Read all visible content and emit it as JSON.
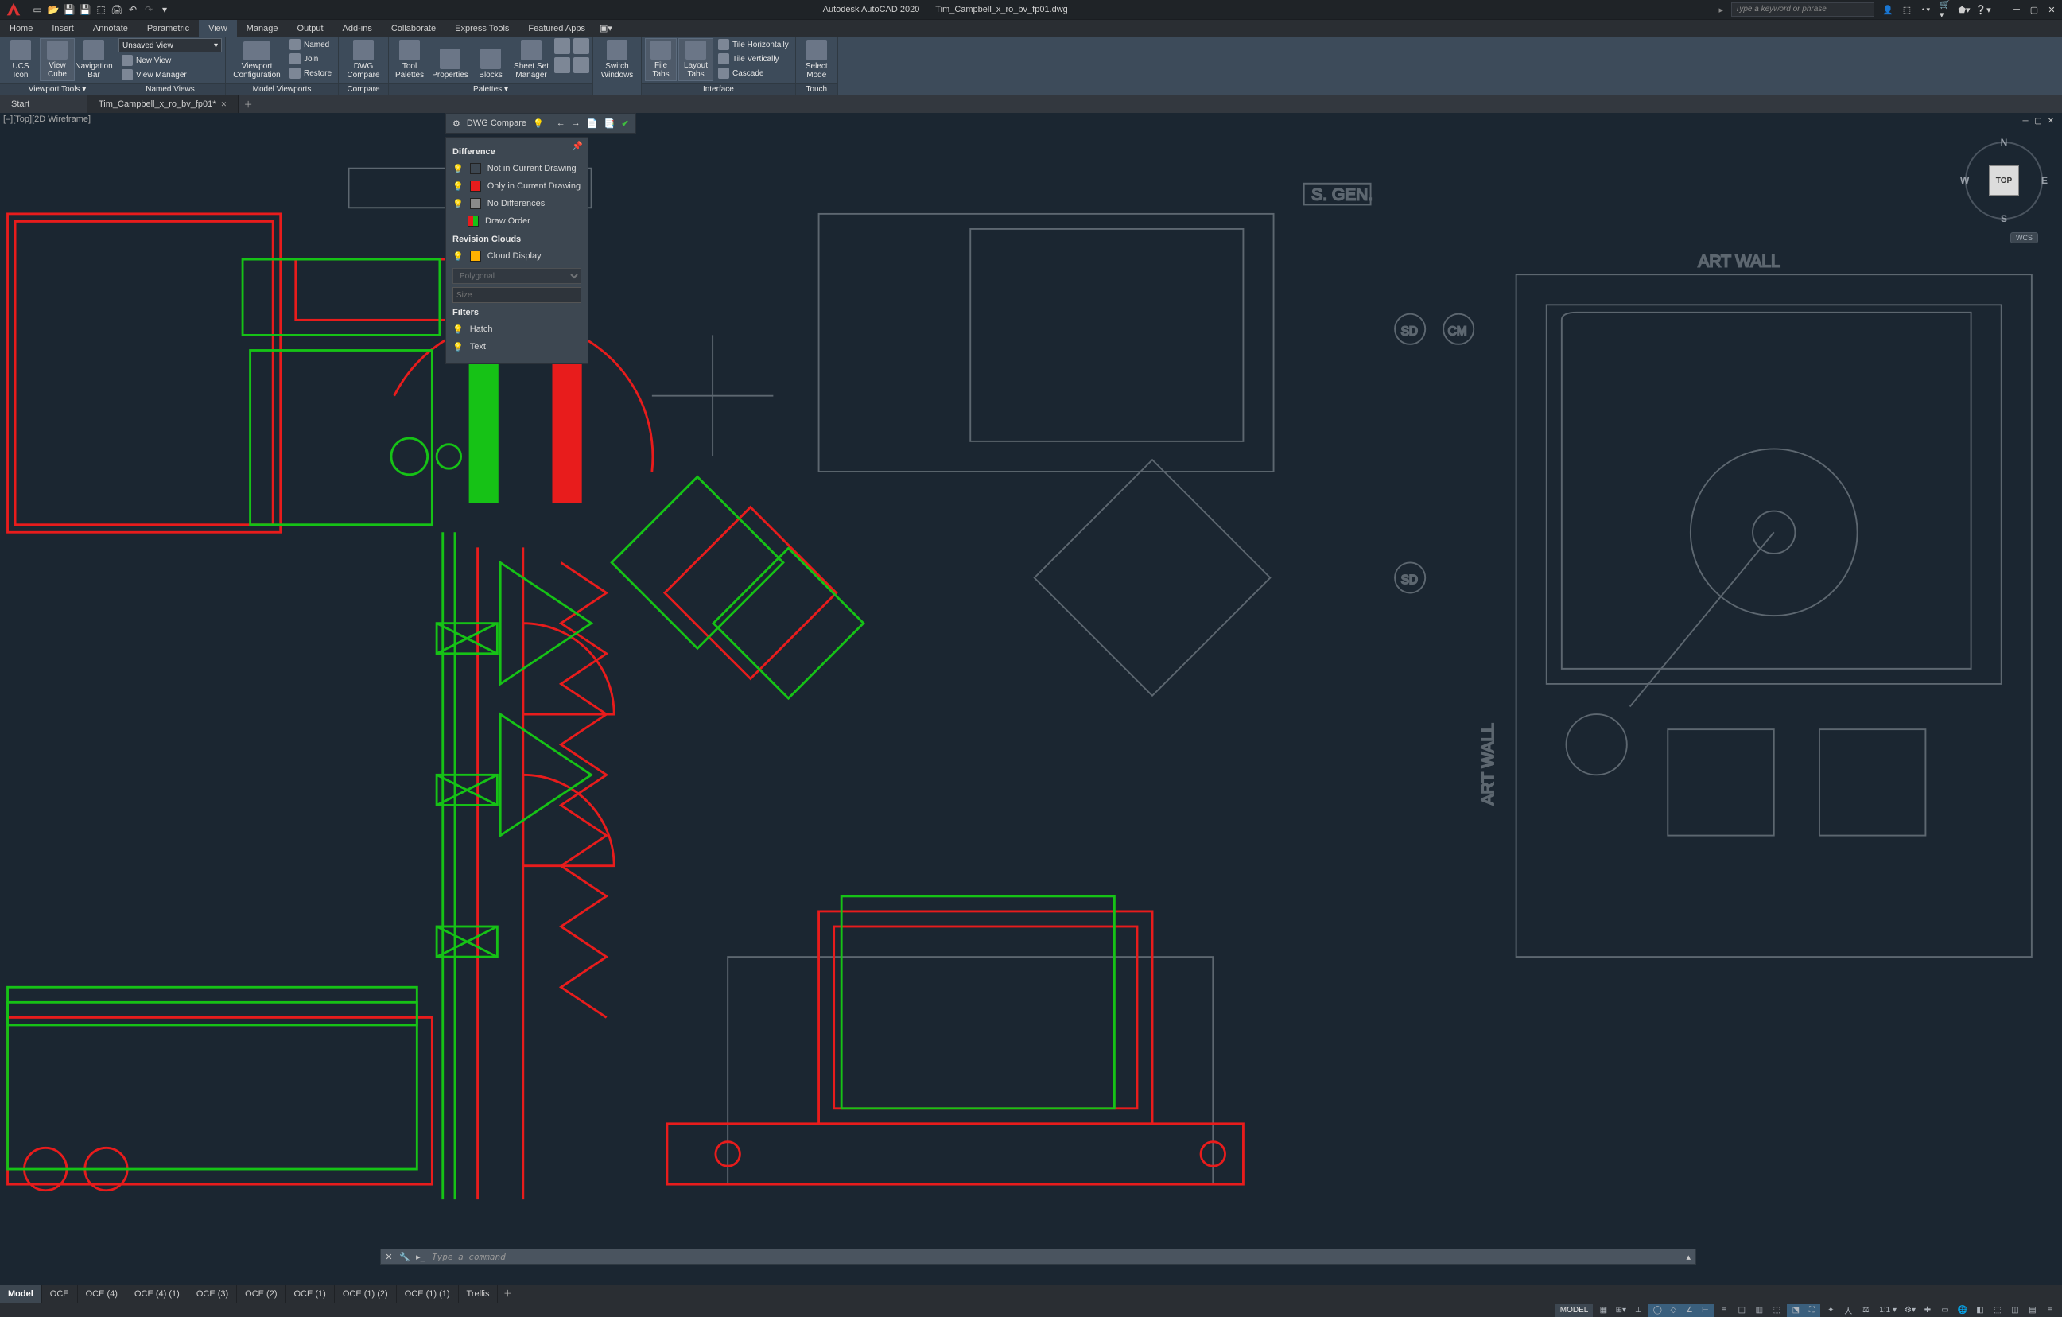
{
  "app": {
    "name": "Autodesk AutoCAD 2020",
    "document": "Tim_Campbell_x_ro_bv_fp01.dwg"
  },
  "search_placeholder": "Type a keyword or phrase",
  "menu_tabs": {
    "items": [
      "Home",
      "Insert",
      "Annotate",
      "Parametric",
      "View",
      "Manage",
      "Output",
      "Add-ins",
      "Collaborate",
      "Express Tools",
      "Featured Apps"
    ],
    "active": "View"
  },
  "ribbon": {
    "viewport_tools": {
      "footer": "Viewport Tools ▾",
      "ucs_icon": "UCS\nIcon",
      "view_cube": "View\nCube",
      "nav_bar": "Navigation\nBar"
    },
    "named_views": {
      "footer": "Named Views",
      "combo": "Unsaved View",
      "new_view": "New View",
      "view_manager": "View Manager"
    },
    "model_viewports": {
      "footer": "Model Viewports",
      "viewport_config": "Viewport\nConfiguration",
      "named": "Named",
      "join": "Join",
      "restore": "Restore"
    },
    "compare": {
      "footer": "Compare",
      "label": "DWG\nCompare"
    },
    "palettes": {
      "footer": "Palettes ▾",
      "tool_palettes": "Tool\nPalettes",
      "properties": "Properties",
      "blocks": "Blocks",
      "sheet_set": "Sheet Set\nManager"
    },
    "windows": {
      "switch": "Switch\nWindows",
      "file_tabs": "File\nTabs",
      "layout_tabs": "Layout\nTabs"
    },
    "interface": {
      "footer": "Interface",
      "tile_h": "Tile Horizontally",
      "tile_v": "Tile Vertically",
      "cascade": "Cascade"
    },
    "touch": {
      "footer": "Touch",
      "select_mode": "Select\nMode"
    }
  },
  "file_tabs": {
    "start": "Start",
    "doc": "Tim_Campbell_x_ro_bv_fp01*"
  },
  "viewport_label": "[–][Top][2D Wireframe]",
  "viewcube": {
    "face": "TOP",
    "n": "N",
    "s": "S",
    "e": "E",
    "w": "W",
    "wcs": "WCS"
  },
  "canvas_text": {
    "art_wall": "ART WALL",
    "art_wall_v": "ART WALL",
    "sgen": "S. GEN.",
    "sd": "SD",
    "cm": "CM"
  },
  "compare_bar": {
    "title": "DWG Compare"
  },
  "compare_panel": {
    "h_diff": "Difference",
    "not_in_current": "Not in Current Drawing",
    "only_in_current": "Only in Current Drawing",
    "no_diff": "No Differences",
    "draw_order": "Draw Order",
    "h_clouds": "Revision Clouds",
    "cloud_display": "Cloud Display",
    "shape": "Polygonal",
    "size_ph": "Size",
    "h_filters": "Filters",
    "hatch": "Hatch",
    "text": "Text",
    "colors": {
      "green": "#16c216",
      "red": "#e81c1c",
      "gray": "#8a8a8a",
      "redgreen_l": "#e81c1c",
      "redgreen_r": "#16c216",
      "yellow": "#ffb200"
    }
  },
  "cmdline": {
    "placeholder": "Type a command"
  },
  "layout_tabs": [
    "Model",
    "OCE",
    "OCE (4)",
    "OCE (4) (1)",
    "OCE (3)",
    "OCE (2)",
    "OCE (1)",
    "OCE (1) (2)",
    "OCE (1) (1)",
    "Trellis"
  ],
  "status": {
    "model": "MODEL",
    "scale": "1:1 ▾"
  }
}
